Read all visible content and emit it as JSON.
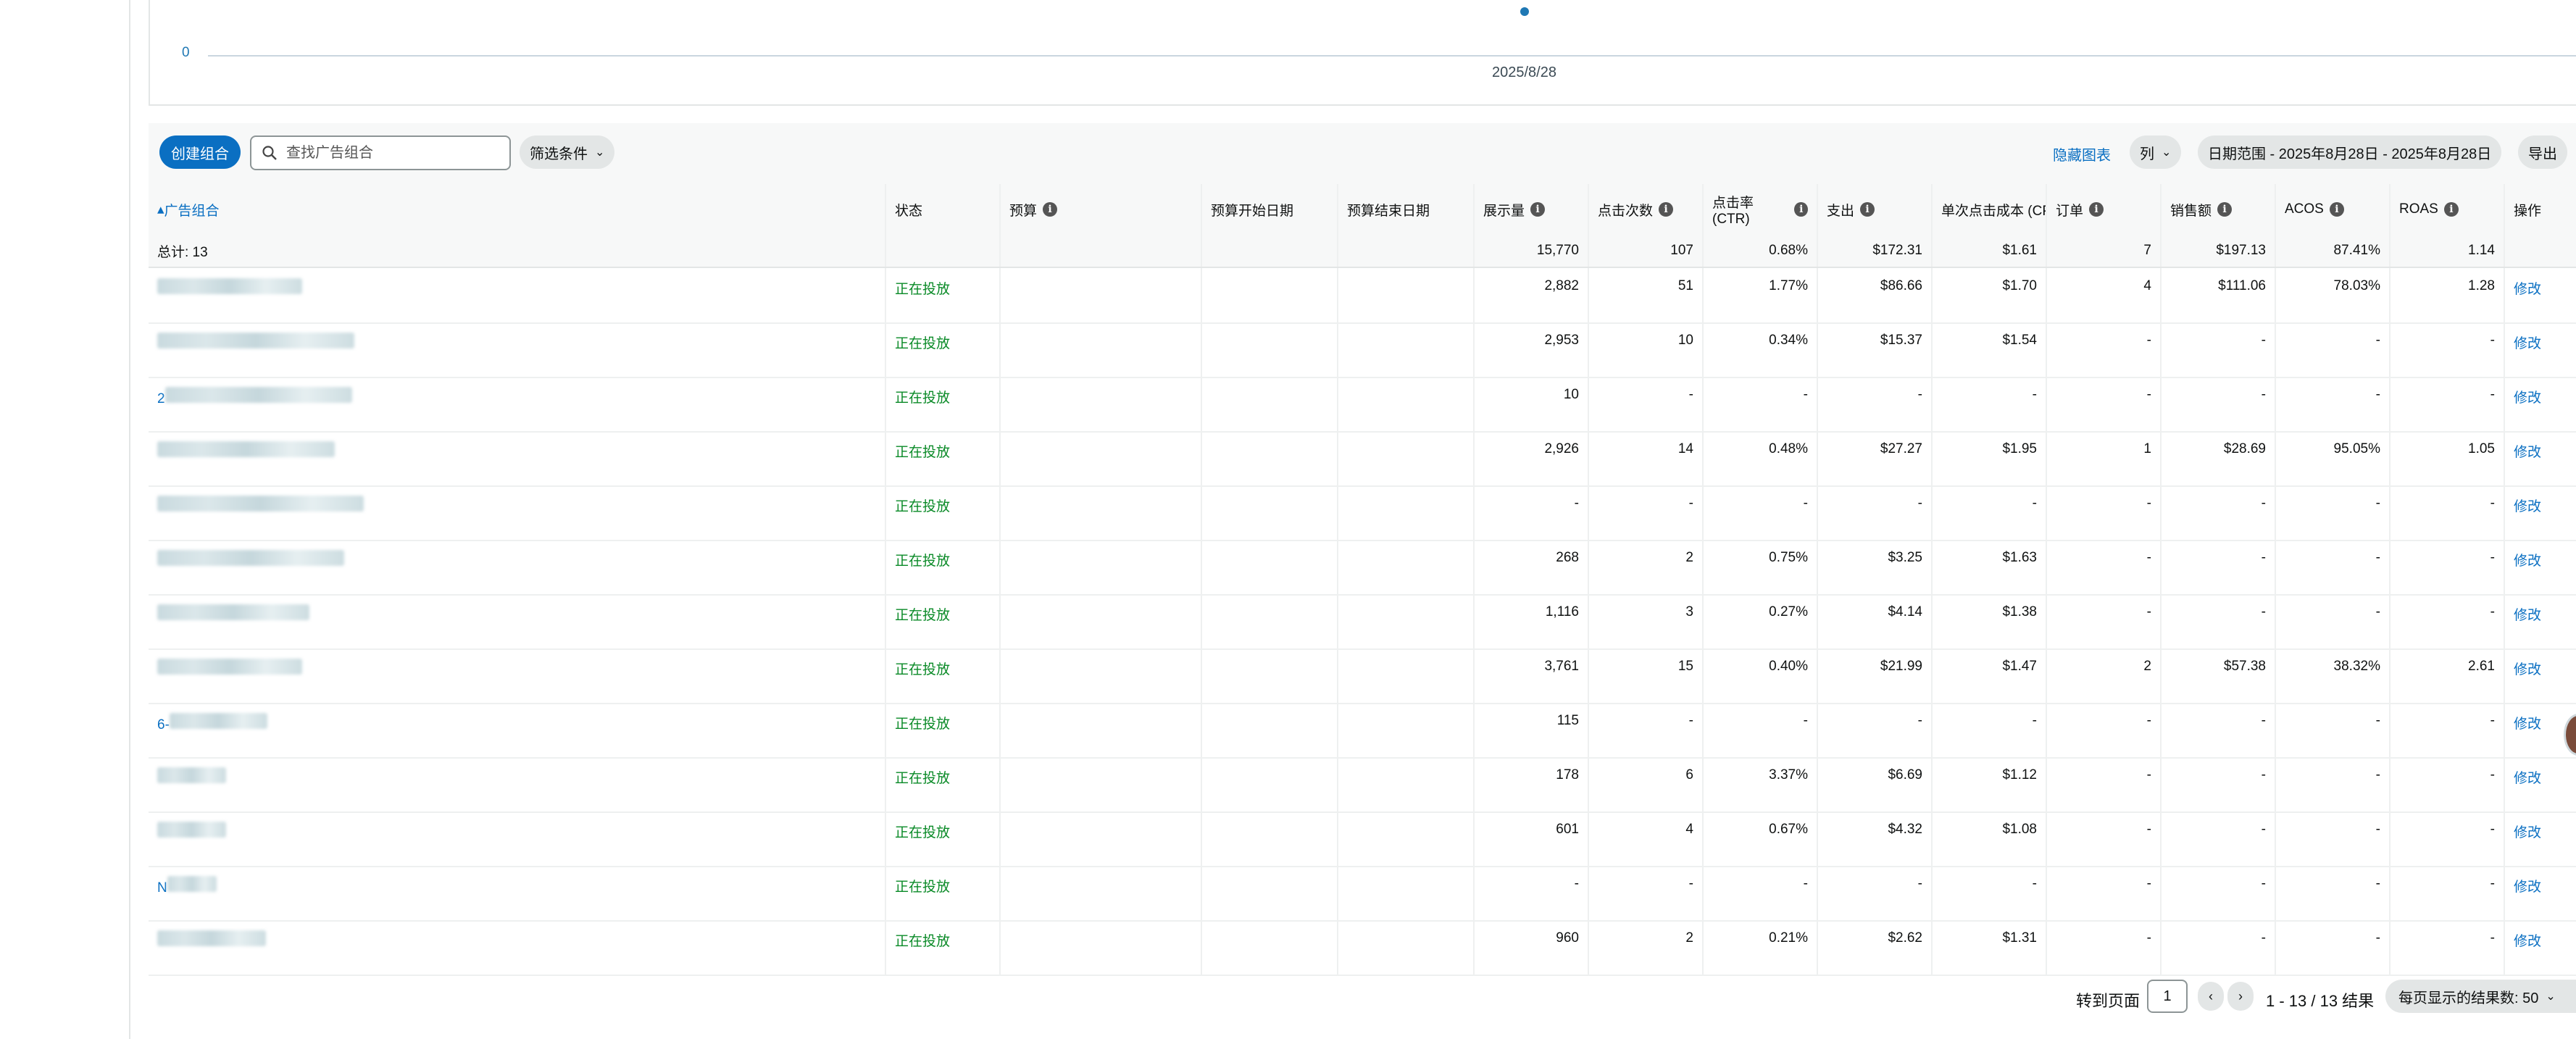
{
  "chart": {
    "zero_label": "0",
    "date_label": "2025/8/28"
  },
  "toolbar": {
    "create_label": "创建组合",
    "search_placeholder": "查找广告组合",
    "filter_label": "筛选条件",
    "hide_chart": "隐藏图表",
    "columns_label": "列",
    "date_range": "日期范围 - 2025年8月28日 - 2025年8月28日",
    "export_label": "导出"
  },
  "table": {
    "headers": {
      "name": "广告组合",
      "status": "状态",
      "budget": "预算",
      "budget_start": "预算开始日期",
      "budget_end": "预算结束日期",
      "impressions": "展示量",
      "clicks": "点击次数",
      "ctr": "点击率 (CTR)",
      "spend": "支出",
      "cpc": "单次点击成本 (CPC)",
      "orders": "订单",
      "sales": "销售额",
      "acos": "ACOS",
      "roas": "ROAS",
      "action": "操作"
    },
    "totals": {
      "label": "总计: 13",
      "impressions": "15,770",
      "clicks": "107",
      "ctr": "0.68%",
      "spend": "$172.31",
      "cpc": "$1.61",
      "orders": "7",
      "sales": "$197.13",
      "acos": "87.41%",
      "roas": "1.14"
    },
    "rows": [
      {
        "prefix": "",
        "status": "正在投放",
        "impressions": "2,882",
        "clicks": "51",
        "ctr": "1.77%",
        "spend": "$86.66",
        "cpc": "$1.70",
        "orders": "4",
        "sales": "$111.06",
        "acos": "78.03%",
        "roas": "1.28",
        "action": "修改"
      },
      {
        "prefix": "",
        "status": "正在投放",
        "impressions": "2,953",
        "clicks": "10",
        "ctr": "0.34%",
        "spend": "$15.37",
        "cpc": "$1.54",
        "orders": "-",
        "sales": "-",
        "acos": "-",
        "roas": "-",
        "action": "修改"
      },
      {
        "prefix": "2",
        "status": "正在投放",
        "impressions": "10",
        "clicks": "-",
        "ctr": "-",
        "spend": "-",
        "cpc": "-",
        "orders": "-",
        "sales": "-",
        "acos": "-",
        "roas": "-",
        "action": "修改"
      },
      {
        "prefix": "",
        "status": "正在投放",
        "impressions": "2,926",
        "clicks": "14",
        "ctr": "0.48%",
        "spend": "$27.27",
        "cpc": "$1.95",
        "orders": "1",
        "sales": "$28.69",
        "acos": "95.05%",
        "roas": "1.05",
        "action": "修改"
      },
      {
        "prefix": "",
        "status": "正在投放",
        "impressions": "-",
        "clicks": "-",
        "ctr": "-",
        "spend": "-",
        "cpc": "-",
        "orders": "-",
        "sales": "-",
        "acos": "-",
        "roas": "-",
        "action": "修改"
      },
      {
        "prefix": "",
        "status": "正在投放",
        "impressions": "268",
        "clicks": "2",
        "ctr": "0.75%",
        "spend": "$3.25",
        "cpc": "$1.63",
        "orders": "-",
        "sales": "-",
        "acos": "-",
        "roas": "-",
        "action": "修改"
      },
      {
        "prefix": "",
        "status": "正在投放",
        "impressions": "1,116",
        "clicks": "3",
        "ctr": "0.27%",
        "spend": "$4.14",
        "cpc": "$1.38",
        "orders": "-",
        "sales": "-",
        "acos": "-",
        "roas": "-",
        "action": "修改"
      },
      {
        "prefix": "",
        "status": "正在投放",
        "impressions": "3,761",
        "clicks": "15",
        "ctr": "0.40%",
        "spend": "$21.99",
        "cpc": "$1.47",
        "orders": "2",
        "sales": "$57.38",
        "acos": "38.32%",
        "roas": "2.61",
        "action": "修改"
      },
      {
        "prefix": "6-",
        "status": "正在投放",
        "impressions": "115",
        "clicks": "-",
        "ctr": "-",
        "spend": "-",
        "cpc": "-",
        "orders": "-",
        "sales": "-",
        "acos": "-",
        "roas": "-",
        "action": "修改"
      },
      {
        "prefix": "",
        "status": "正在投放",
        "impressions": "178",
        "clicks": "6",
        "ctr": "3.37%",
        "spend": "$6.69",
        "cpc": "$1.12",
        "orders": "-",
        "sales": "-",
        "acos": "-",
        "roas": "-",
        "action": "修改"
      },
      {
        "prefix": "",
        "status": "正在投放",
        "impressions": "601",
        "clicks": "4",
        "ctr": "0.67%",
        "spend": "$4.32",
        "cpc": "$1.08",
        "orders": "-",
        "sales": "-",
        "acos": "-",
        "roas": "-",
        "action": "修改"
      },
      {
        "prefix": "N",
        "status": "正在投放",
        "impressions": "-",
        "clicks": "-",
        "ctr": "-",
        "spend": "-",
        "cpc": "-",
        "orders": "-",
        "sales": "-",
        "acos": "-",
        "roas": "-",
        "action": "修改"
      },
      {
        "prefix": "",
        "status": "正在投放",
        "impressions": "960",
        "clicks": "2",
        "ctr": "0.21%",
        "spend": "$2.62",
        "cpc": "$1.31",
        "orders": "-",
        "sales": "-",
        "acos": "-",
        "roas": "-",
        "action": "修改"
      }
    ]
  },
  "footer": {
    "goto_label": "转到页面",
    "page_value": "1",
    "result_text": "1 - 13 / 13 结果",
    "per_page_label": "每页显示的结果数: 50"
  }
}
